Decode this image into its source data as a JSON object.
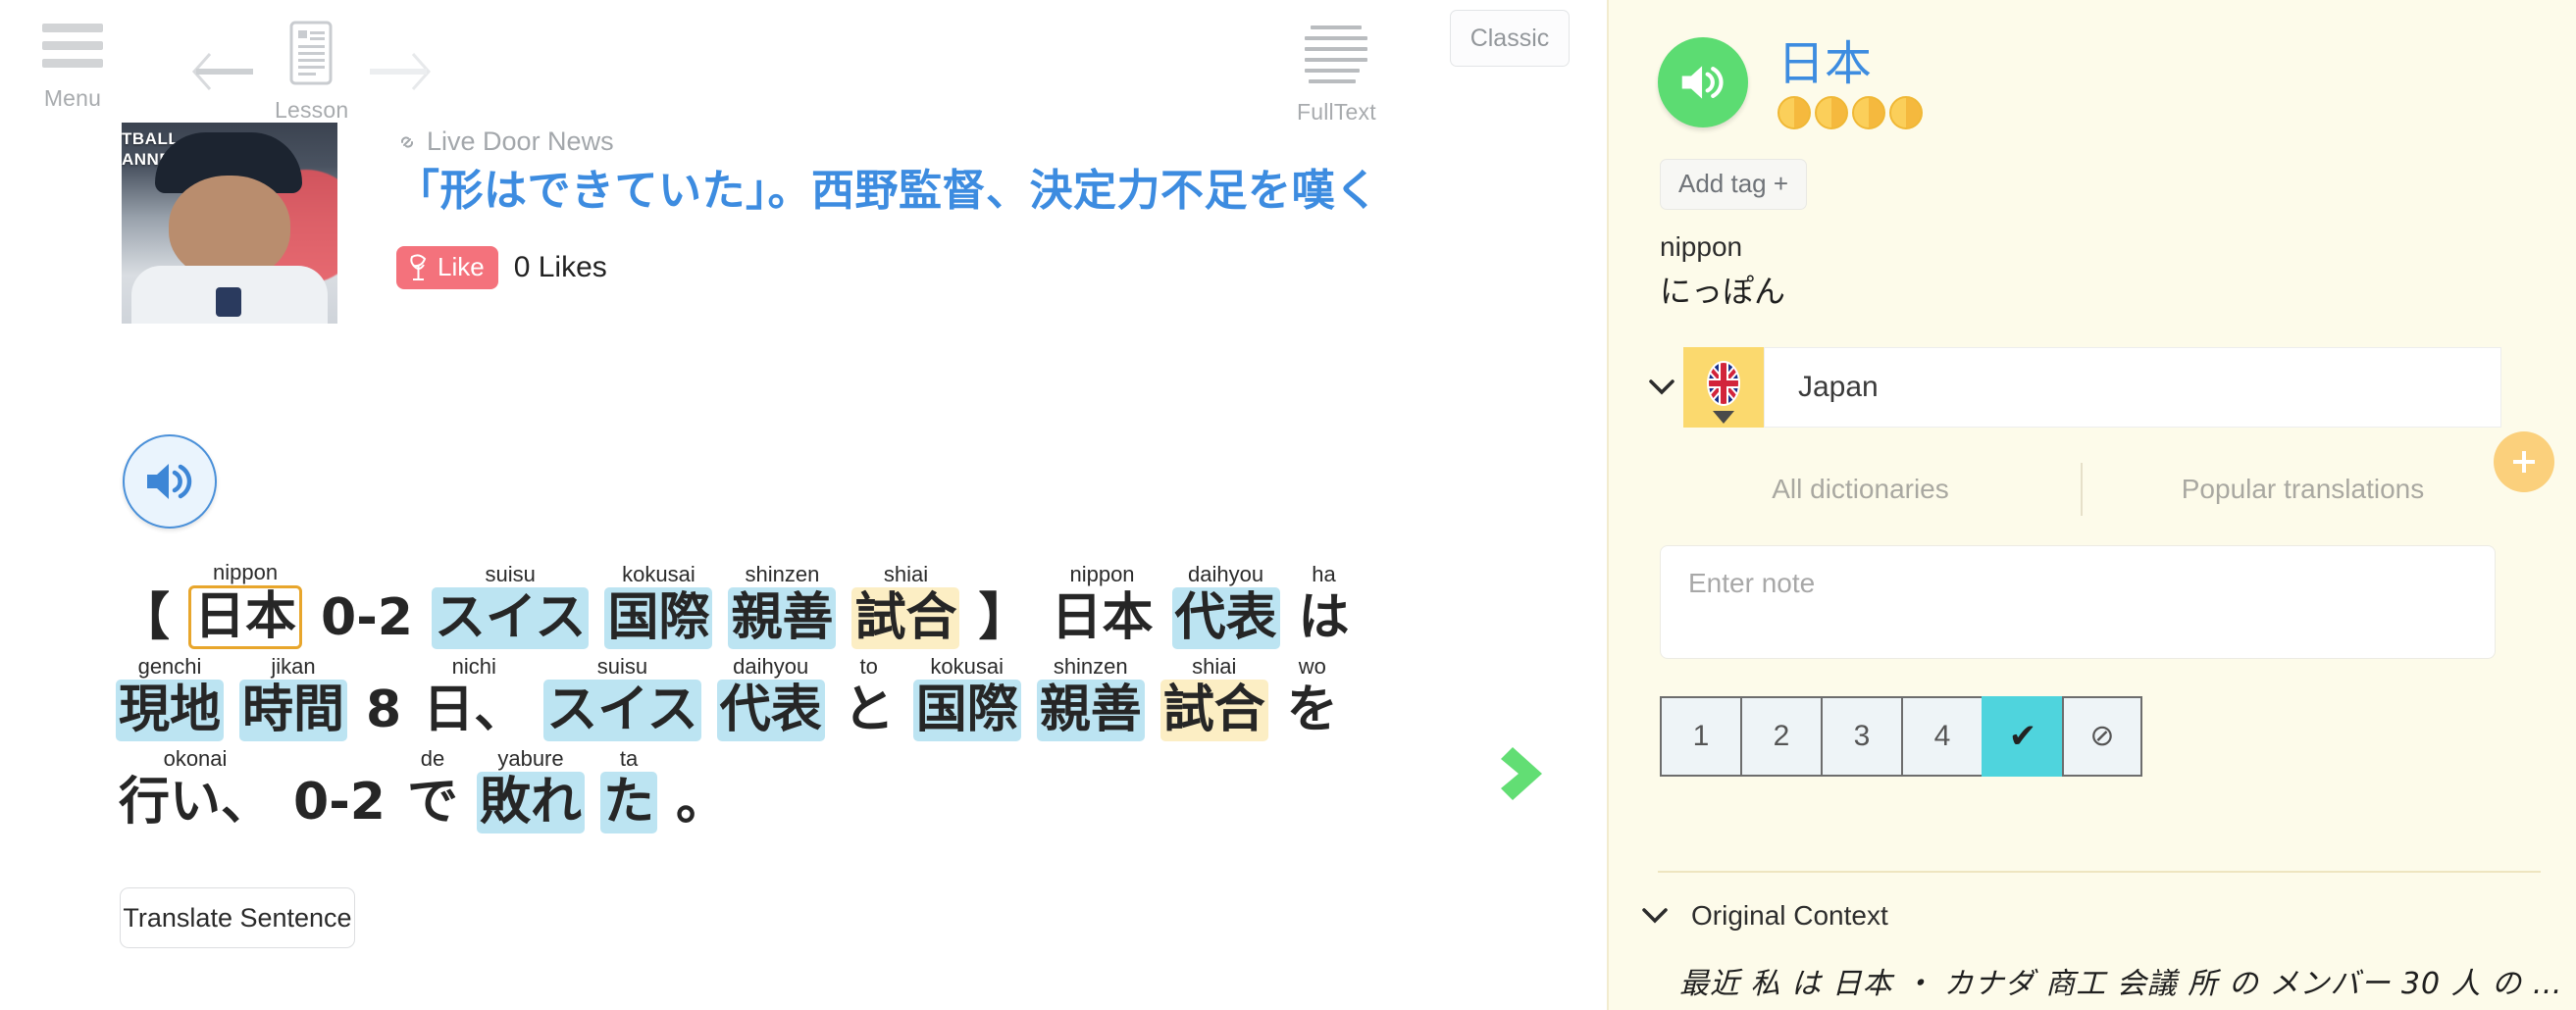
{
  "toolbar": {
    "menu_label": "Menu",
    "lesson_label": "Lesson",
    "fulltext_label": "FullText",
    "classic_label": "Classic",
    "prev_icon": "arrow-left-icon",
    "next_icon": "arrow-right-icon",
    "menu_icon": "hamburger-icon",
    "lesson_icon": "document-icon",
    "fulltext_icon": "text-lines-icon"
  },
  "article": {
    "source": "Live Door News",
    "source_icon": "link-icon",
    "headline": "「形はできていた」。西野監督、決定力不足を嘆く",
    "like_label": "Like",
    "like_icon": "rose-icon",
    "like_count": "0 Likes",
    "thumb_overlay_text": "TBALL\nANNEL"
  },
  "reader": {
    "play_sentence_icon": "speaker-icon",
    "translate_button": "Translate Sentence",
    "next_sentence_icon": "chevron-right-icon",
    "accent_blue": "#3d8ce0",
    "highlight_blue": "#bce4f2",
    "highlight_cream": "#fceec4",
    "selected_outline": "#e8a62c",
    "lines": [
      [
        {
          "rb": "【",
          "rt": "",
          "style": "plain"
        },
        {
          "rb": "日本",
          "rt": "nippon",
          "style": "hl-box"
        },
        {
          "rb": "0-2",
          "rt": "",
          "style": "plain"
        },
        {
          "rb": "スイス",
          "rt": "suisu",
          "style": "hl-blue"
        },
        {
          "rb": "国際",
          "rt": "kokusai",
          "style": "hl-blue"
        },
        {
          "rb": "親善",
          "rt": "shinzen",
          "style": "hl-blue"
        },
        {
          "rb": "試合",
          "rt": "shiai",
          "style": "hl-cream"
        },
        {
          "rb": "】",
          "rt": "",
          "style": "plain"
        },
        {
          "rb": "日本",
          "rt": "nippon",
          "style": "plain"
        },
        {
          "rb": "代表",
          "rt": "daihyou",
          "style": "hl-blue"
        },
        {
          "rb": "は",
          "rt": "ha",
          "style": "plain"
        }
      ],
      [
        {
          "rb": "現地",
          "rt": "genchi",
          "style": "hl-blue"
        },
        {
          "rb": "時間",
          "rt": "jikan",
          "style": "hl-blue"
        },
        {
          "rb": "8",
          "rt": "",
          "style": "plain"
        },
        {
          "rb": "日、",
          "rt": "nichi",
          "style": "plain"
        },
        {
          "rb": "スイス",
          "rt": "suisu",
          "style": "hl-blue"
        },
        {
          "rb": "代表",
          "rt": "daihyou",
          "style": "hl-blue"
        },
        {
          "rb": "と",
          "rt": "to",
          "style": "plain"
        },
        {
          "rb": "国際",
          "rt": "kokusai",
          "style": "hl-blue"
        },
        {
          "rb": "親善",
          "rt": "shinzen",
          "style": "hl-blue"
        },
        {
          "rb": "試合",
          "rt": "shiai",
          "style": "hl-cream"
        },
        {
          "rb": "を",
          "rt": "wo",
          "style": "plain"
        }
      ],
      [
        {
          "rb": "行い、",
          "rt": "okonai",
          "style": "plain"
        },
        {
          "rb": "0-2",
          "rt": "",
          "style": "plain"
        },
        {
          "rb": "で",
          "rt": "de",
          "style": "plain"
        },
        {
          "rb": "敗れ",
          "rt": "yabure",
          "style": "hl-blue"
        },
        {
          "rb": "た",
          "rt": "ta",
          "style": "hl-blue"
        },
        {
          "rb": "。",
          "rt": "",
          "style": "plain"
        }
      ]
    ]
  },
  "panel": {
    "play_word_icon": "speaker-icon",
    "word": "日本",
    "coins": 4,
    "coin_icon": "coin-icon",
    "add_tag_label": "Add tag +",
    "romaji": "nippon",
    "kana": "にっぽん",
    "collapse_icon": "chevron-down-icon",
    "flag_icon": "uk-flag-icon",
    "translation_value": "Japan",
    "add_translation_icon": "plus-icon",
    "dict_tabs": [
      "All dictionaries",
      "Popular translations"
    ],
    "note_placeholder": "Enter note",
    "ratings": [
      "1",
      "2",
      "3",
      "4",
      "✔",
      "⊘"
    ],
    "active_rating_index": 4,
    "active_rating_color": "#4fd4dd",
    "context_title": "Original Context",
    "context_text": "最近 私 は 日本 ・ カナダ 商工 会議 所 の メンバー 30 人 の …"
  }
}
